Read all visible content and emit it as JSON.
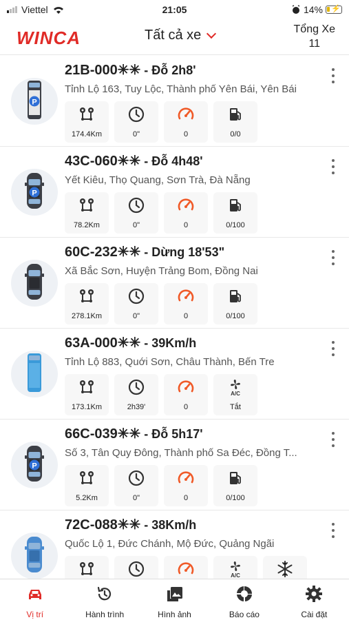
{
  "status_bar": {
    "carrier": "Viettel",
    "time": "21:05",
    "battery": "14%"
  },
  "header": {
    "logo": "WINCA",
    "title": "Tất cả xe",
    "total_label": "Tổng Xe",
    "total_count": "11"
  },
  "colors": {
    "brand": "#e02b27",
    "gauge": "#f05a28",
    "icon": "#333333"
  },
  "vehicles": [
    {
      "plate": "21B-000✳✳",
      "status": " - Đỗ 2h8'",
      "address": "Tỉnh Lộ 163, Tuy Lộc, Thành phố Yên Bái, Yên Bái",
      "type": "truck",
      "parked": true,
      "stats": [
        {
          "icon": "route-icon",
          "value": "174.4Km"
        },
        {
          "icon": "clock-icon",
          "value": "0\""
        },
        {
          "icon": "speedometer-icon",
          "value": "0"
        },
        {
          "icon": "fuel-icon",
          "value": "0/0"
        }
      ]
    },
    {
      "plate": "43C-060✳✳",
      "status": " - Đỗ 4h48'",
      "address": "Yết Kiêu, Thọ Quang, Sơn Trà, Đà Nẵng",
      "type": "car",
      "parked": true,
      "stats": [
        {
          "icon": "route-icon",
          "value": "78.2Km"
        },
        {
          "icon": "clock-icon",
          "value": "0\""
        },
        {
          "icon": "speedometer-icon",
          "value": "0"
        },
        {
          "icon": "fuel-icon",
          "value": "0/100"
        }
      ]
    },
    {
      "plate": "60C-232✳✳",
      "status": " - Dừng 18'53\"",
      "address": "Xã Bắc Sơn, Huyện Trảng Bom, Đồng Nai",
      "type": "car",
      "parked": false,
      "stats": [
        {
          "icon": "route-icon",
          "value": "278.1Km"
        },
        {
          "icon": "clock-icon",
          "value": "0\""
        },
        {
          "icon": "speedometer-icon",
          "value": "0"
        },
        {
          "icon": "fuel-icon",
          "value": "0/100"
        }
      ]
    },
    {
      "plate": "63A-000✳✳",
      "status": " - 39Km/h",
      "address": "Tỉnh Lộ 883, Quới Sơn, Châu Thành, Bến Tre",
      "type": "bus",
      "parked": false,
      "stats": [
        {
          "icon": "route-icon",
          "value": "173.1Km"
        },
        {
          "icon": "clock-icon",
          "value": "2h39'"
        },
        {
          "icon": "speedometer-icon",
          "value": "0"
        },
        {
          "icon": "ac-icon",
          "value": "Tắt"
        }
      ]
    },
    {
      "plate": "66C-039✳✳",
      "status": " - Đỗ 5h17'",
      "address": "Số 3, Tân Quy Đông, Thành phố Sa Đéc, Đồng T...",
      "type": "car",
      "parked": true,
      "stats": [
        {
          "icon": "route-icon",
          "value": "5.2Km"
        },
        {
          "icon": "clock-icon",
          "value": "0\""
        },
        {
          "icon": "speedometer-icon",
          "value": "0"
        },
        {
          "icon": "fuel-icon",
          "value": "0/100"
        }
      ]
    },
    {
      "plate": "72C-088✳✳",
      "status": " - 38Km/h",
      "address": "Quốc Lộ 1, Đức Chánh, Mộ Đức, Quảng Ngãi",
      "type": "car-blue",
      "parked": false,
      "stats": [
        {
          "icon": "route-icon",
          "value": ""
        },
        {
          "icon": "clock-icon",
          "value": ""
        },
        {
          "icon": "speedometer-icon",
          "value": ""
        },
        {
          "icon": "ac-icon",
          "value": ""
        },
        {
          "icon": "snowflake-icon",
          "value": ""
        }
      ]
    }
  ],
  "tabs": [
    {
      "label": "Vị trí",
      "icon": "car-icon",
      "active": true
    },
    {
      "label": "Hành trình",
      "icon": "history-icon",
      "active": false
    },
    {
      "label": "Hình ảnh",
      "icon": "image-icon",
      "active": false
    },
    {
      "label": "Báo cáo",
      "icon": "report-icon",
      "active": false
    },
    {
      "label": "Cài đặt",
      "icon": "settings-icon",
      "active": false
    }
  ]
}
